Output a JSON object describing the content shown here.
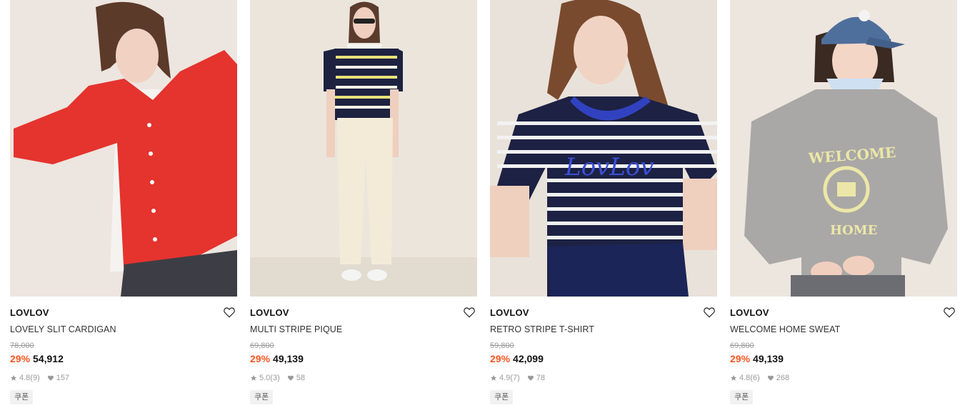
{
  "products": [
    {
      "brand": "LOVLOV",
      "name": "LOVELY SLIT CARDIGAN",
      "original_price": "78,000",
      "discount": "29%",
      "price": "54,912",
      "rating": "4.8",
      "review_count": "(9)",
      "likes": "157",
      "badge": "쿠폰"
    },
    {
      "brand": "LOVLOV",
      "name": "MULTI STRIPE PIQUE",
      "original_price": "69,800",
      "discount": "29%",
      "price": "49,139",
      "rating": "5.0",
      "review_count": "(3)",
      "likes": "58",
      "badge": "쿠폰"
    },
    {
      "brand": "LOVLOV",
      "name": "RETRO STRIPE T-SHIRT",
      "original_price": "59,800",
      "discount": "29%",
      "price": "42,099",
      "rating": "4.9",
      "review_count": "(7)",
      "likes": "78",
      "badge": "쿠폰"
    },
    {
      "brand": "LOVLOV",
      "name": "WELCOME HOME SWEAT",
      "original_price": "69,800",
      "discount": "29%",
      "price": "49,139",
      "rating": "4.8",
      "review_count": "(6)",
      "likes": "268",
      "badge": "쿠폰"
    }
  ],
  "colors": {
    "discount": "#f0571f",
    "muted": "#9a9a9a",
    "badge_bg": "#f1f1f1"
  }
}
